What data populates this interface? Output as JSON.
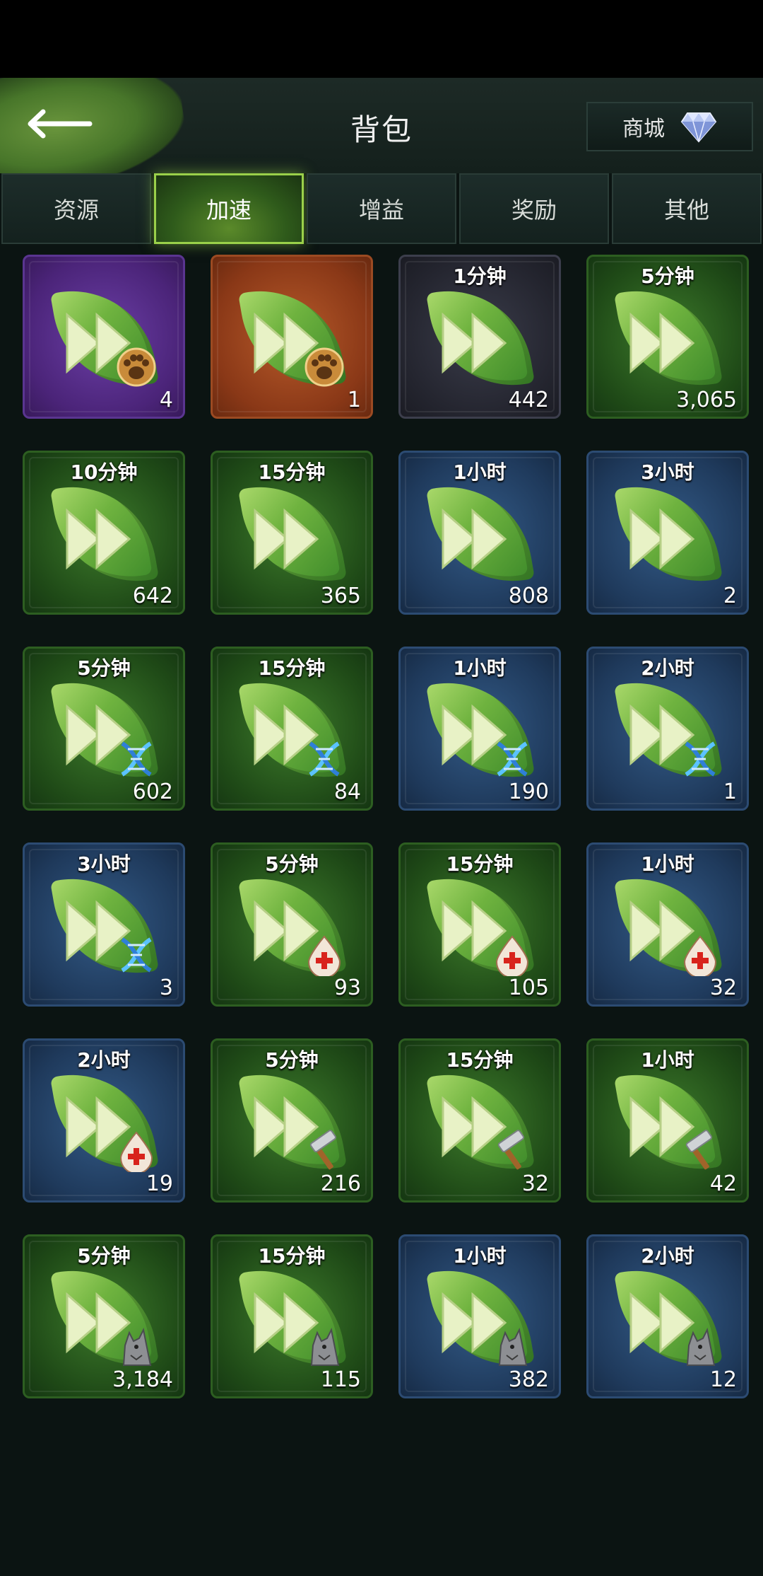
{
  "header": {
    "title": "背包",
    "shop_label": "商城",
    "back_icon": "back-arrow-icon",
    "shop_icon": "diamond-icon"
  },
  "tabs": [
    {
      "label": "资源",
      "active": false
    },
    {
      "label": "加速",
      "active": true
    },
    {
      "label": "增益",
      "active": false
    },
    {
      "label": "奖励",
      "active": false
    },
    {
      "label": "其他",
      "active": false
    }
  ],
  "items": [
    {
      "duration": "",
      "count": "4",
      "bg": "purple",
      "badge": "paw"
    },
    {
      "duration": "",
      "count": "1",
      "bg": "orange",
      "badge": "paw"
    },
    {
      "duration": "1分钟",
      "count": "442",
      "bg": "dark",
      "badge": ""
    },
    {
      "duration": "5分钟",
      "count": "3,065",
      "bg": "green",
      "badge": ""
    },
    {
      "duration": "10分钟",
      "count": "642",
      "bg": "green",
      "badge": ""
    },
    {
      "duration": "15分钟",
      "count": "365",
      "bg": "green",
      "badge": ""
    },
    {
      "duration": "1小时",
      "count": "808",
      "bg": "blue",
      "badge": ""
    },
    {
      "duration": "3小时",
      "count": "2",
      "bg": "blue",
      "badge": ""
    },
    {
      "duration": "5分钟",
      "count": "602",
      "bg": "green",
      "badge": "dna"
    },
    {
      "duration": "15分钟",
      "count": "84",
      "bg": "green",
      "badge": "dna"
    },
    {
      "duration": "1小时",
      "count": "190",
      "bg": "blue",
      "badge": "dna"
    },
    {
      "duration": "2小时",
      "count": "1",
      "bg": "blue",
      "badge": "dna"
    },
    {
      "duration": "3小时",
      "count": "3",
      "bg": "blue",
      "badge": "dna"
    },
    {
      "duration": "5分钟",
      "count": "93",
      "bg": "green",
      "badge": "blood"
    },
    {
      "duration": "15分钟",
      "count": "105",
      "bg": "green",
      "badge": "blood"
    },
    {
      "duration": "1小时",
      "count": "32",
      "bg": "blue",
      "badge": "blood"
    },
    {
      "duration": "2小时",
      "count": "19",
      "bg": "blue",
      "badge": "blood"
    },
    {
      "duration": "5分钟",
      "count": "216",
      "bg": "green",
      "badge": "hammer"
    },
    {
      "duration": "15分钟",
      "count": "32",
      "bg": "green",
      "badge": "hammer"
    },
    {
      "duration": "1小时",
      "count": "42",
      "bg": "green",
      "badge": "hammer"
    },
    {
      "duration": "5分钟",
      "count": "3,184",
      "bg": "green",
      "badge": "wolf"
    },
    {
      "duration": "15分钟",
      "count": "115",
      "bg": "green",
      "badge": "wolf"
    },
    {
      "duration": "1小时",
      "count": "382",
      "bg": "blue",
      "badge": "wolf"
    },
    {
      "duration": "2小时",
      "count": "12",
      "bg": "blue",
      "badge": "wolf"
    }
  ]
}
